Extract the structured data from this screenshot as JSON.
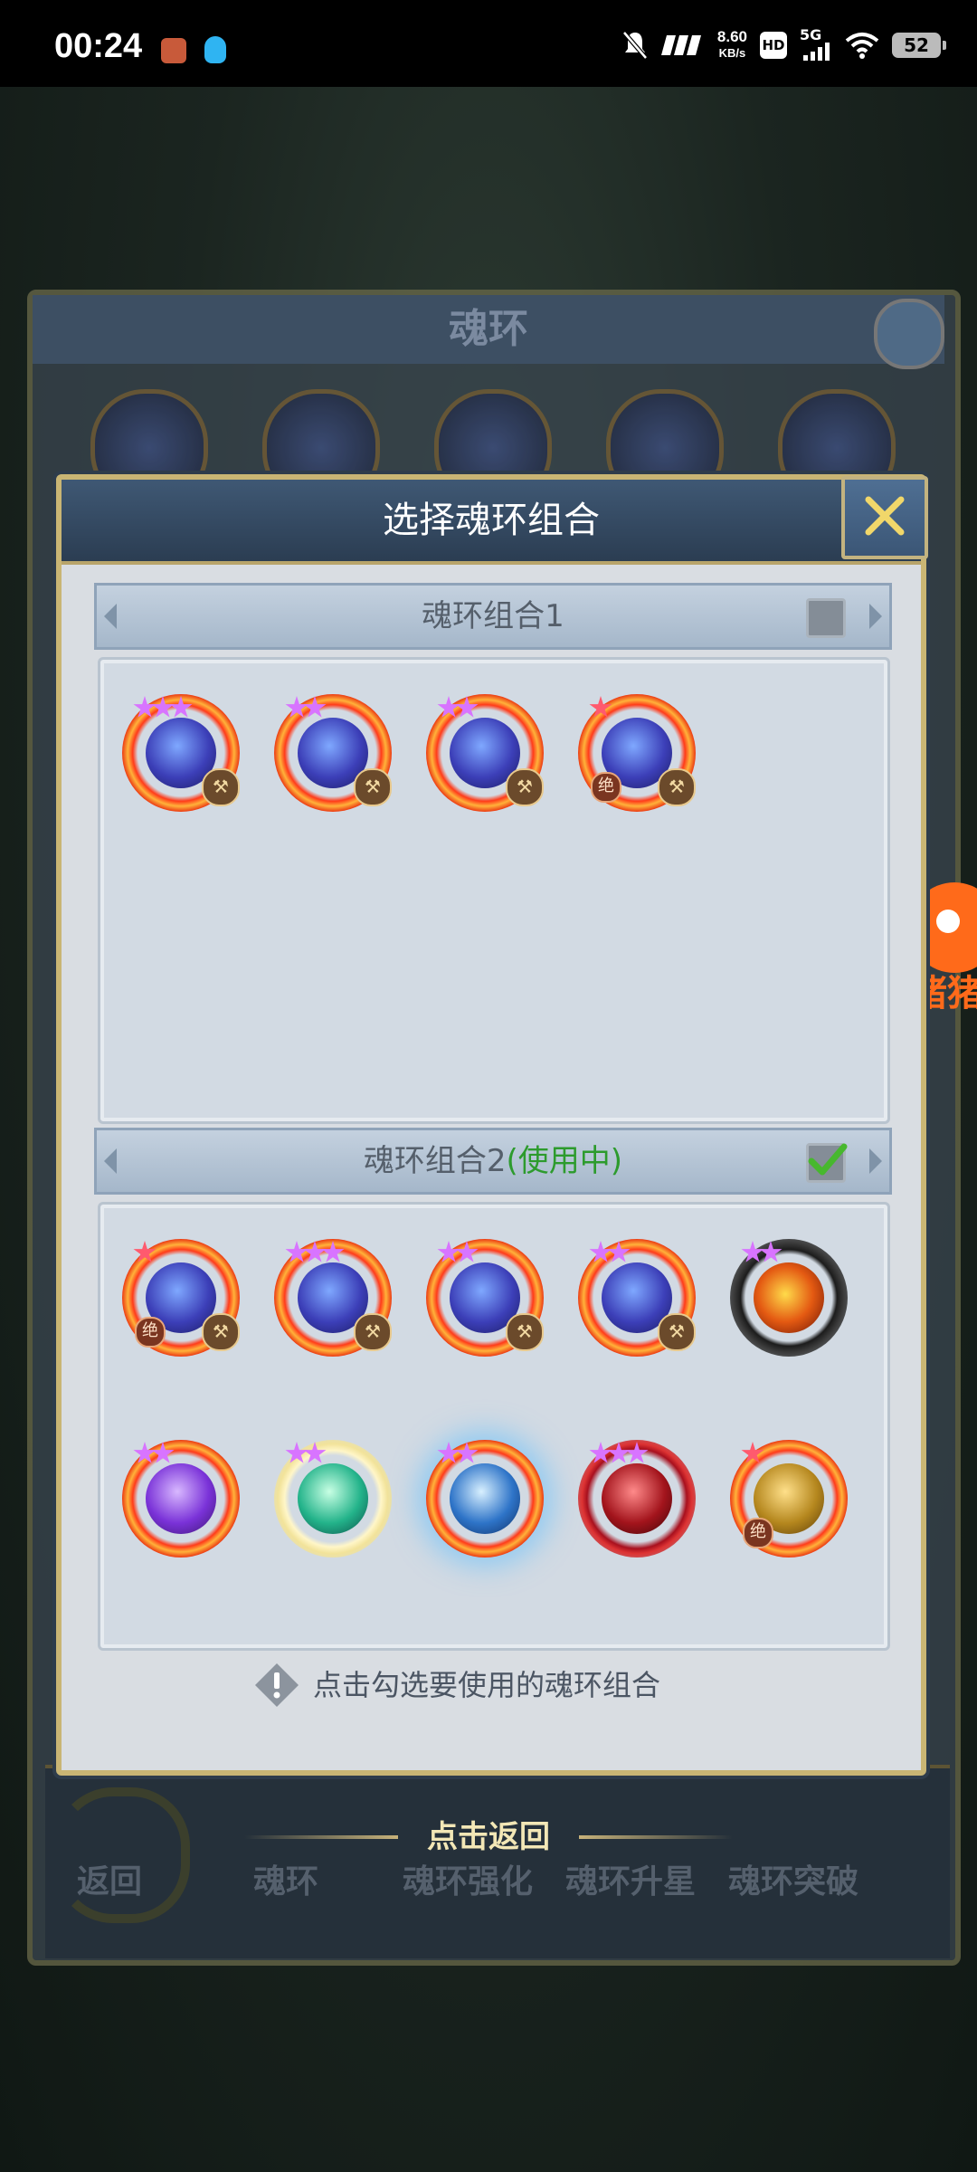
{
  "status_bar": {
    "time": "00:24",
    "net_speed_value": "8.60",
    "net_speed_unit": "KB/s",
    "hd_label": "HD",
    "network_label": "5G",
    "battery": "52"
  },
  "background": {
    "panel_title": "魂环",
    "back_label": "返回",
    "bottom_tabs": [
      "魂环",
      "魂环强化",
      "魂环升星",
      "魂环突破"
    ],
    "watermark": "猪猪"
  },
  "modal": {
    "title": "选择魂环组合",
    "group1": {
      "label": "魂环组合1",
      "checked": false,
      "rings": [
        {
          "icon": "sword-spirit-icon",
          "stars": 3,
          "star_color": "purple",
          "hammer": true,
          "jue": false
        },
        {
          "icon": "trident-spirit-icon",
          "stars": 2,
          "star_color": "purple",
          "hammer": true,
          "jue": false
        },
        {
          "icon": "hammer-spirit-icon",
          "stars": 2,
          "star_color": "purple",
          "hammer": true,
          "jue": false
        },
        {
          "icon": "warrior-spirit-icon",
          "stars": 1,
          "star_color": "red",
          "hammer": true,
          "jue": true
        }
      ]
    },
    "group2": {
      "label": "魂环组合2",
      "status": "(使用中)",
      "checked": true,
      "rings": [
        {
          "icon": "warrior-spirit-icon",
          "stars": 1,
          "star_color": "red",
          "hammer": true,
          "jue": true,
          "style": ""
        },
        {
          "icon": "sword-spirit-icon",
          "stars": 3,
          "star_color": "purple",
          "hammer": true,
          "jue": false,
          "style": ""
        },
        {
          "icon": "hammer-spirit-icon",
          "stars": 2,
          "star_color": "purple",
          "hammer": true,
          "jue": false,
          "style": ""
        },
        {
          "icon": "trident-spirit-icon",
          "stars": 2,
          "star_color": "purple",
          "hammer": true,
          "jue": false,
          "style": ""
        },
        {
          "icon": "flame-beast-icon",
          "stars": 2,
          "star_color": "purple",
          "hammer": false,
          "jue": false,
          "style": "flame"
        },
        {
          "icon": "thunder-icon",
          "stars": 2,
          "star_color": "purple",
          "hammer": false,
          "jue": false,
          "style": "thunder"
        },
        {
          "icon": "leaf-spirit-icon",
          "stars": 2,
          "star_color": "purple",
          "hammer": false,
          "jue": false,
          "style": "leaf"
        },
        {
          "icon": "shark-icon",
          "stars": 2,
          "star_color": "purple",
          "hammer": false,
          "jue": false,
          "style": "shark"
        },
        {
          "icon": "blood-demon-icon",
          "stars": 3,
          "star_color": "purple",
          "hammer": false,
          "jue": false,
          "style": "blood"
        },
        {
          "icon": "golden-fist-icon",
          "stars": 1,
          "star_color": "red",
          "hammer": false,
          "jue": true,
          "style": "fist"
        }
      ]
    },
    "hint": "点击勾选要使用的魂环组合",
    "hammer_glyph": "⚒",
    "jue_glyph": "绝"
  },
  "return_label": "点击返回"
}
